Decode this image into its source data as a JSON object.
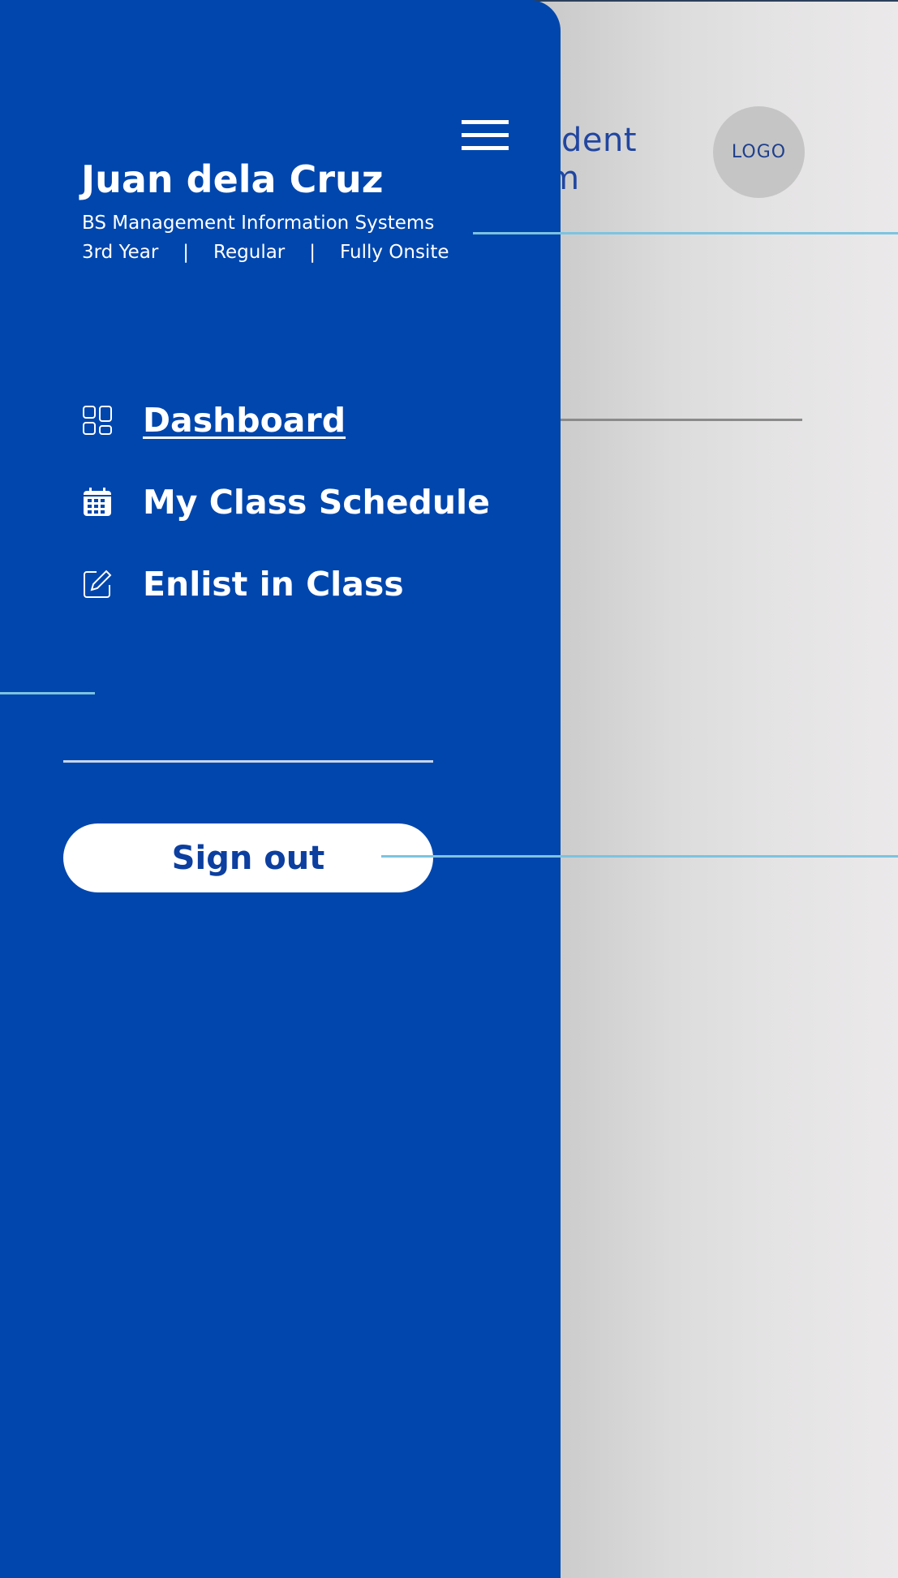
{
  "background": {
    "app_title_partial": "tudent em",
    "app_title_line1": "tudent",
    "app_title_line2": "em",
    "logo_text": "LOGO"
  },
  "drawer": {
    "user": {
      "name": "Juan dela Cruz",
      "program": "BS Management Information Systems",
      "year": "3rd Year",
      "status": "Regular",
      "modality": "Fully Onsite",
      "separator": "|"
    },
    "nav": [
      {
        "label": "Dashboard",
        "icon": "dashboard-icon",
        "active": true
      },
      {
        "label": "My Class Schedule",
        "icon": "calendar-icon",
        "active": false
      },
      {
        "label": "Enlist in Class",
        "icon": "edit-icon",
        "active": false
      }
    ],
    "signout_label": "Sign out"
  },
  "colors": {
    "drawer_bg": "#0046ad",
    "accent_line": "#7cc3e0",
    "signout_text": "#0c3f9f"
  }
}
